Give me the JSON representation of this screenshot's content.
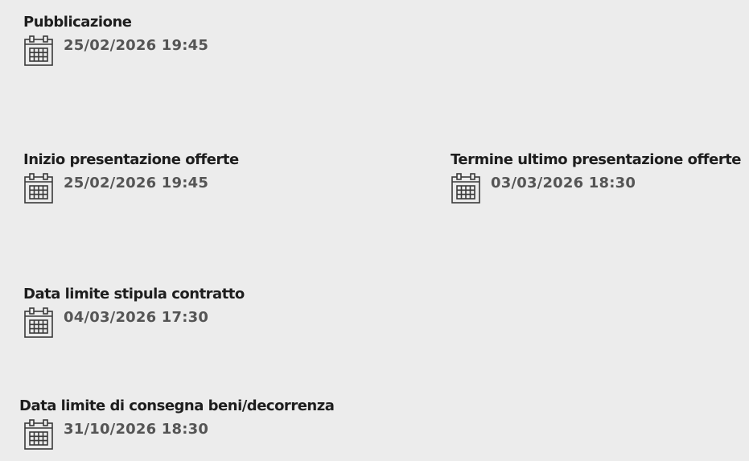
{
  "dates": {
    "pubblicazione": {
      "label": "Pubblicazione",
      "value": "25/02/2026 19:45",
      "icon": "calendar-icon"
    },
    "inizio_presentazione": {
      "label": "Inizio presentazione offerte",
      "value": "25/02/2026 19:45",
      "icon": "calendar-icon"
    },
    "termine_presentazione": {
      "label": "Termine ultimo presentazione offerte",
      "value": "03/03/2026 18:30",
      "icon": "calendar-icon"
    },
    "stipula_contratto": {
      "label": "Data limite stipula contratto",
      "value": "04/03/2026 17:30",
      "icon": "calendar-icon"
    },
    "consegna_beni": {
      "label": "Data limite di consegna beni/decorrenza",
      "value": "31/10/2026 18:30",
      "icon": "calendar-icon"
    }
  },
  "colors": {
    "background": "#ececec",
    "label": "#1e1e1e",
    "value": "#555555",
    "icon": "#3a3a3a"
  }
}
